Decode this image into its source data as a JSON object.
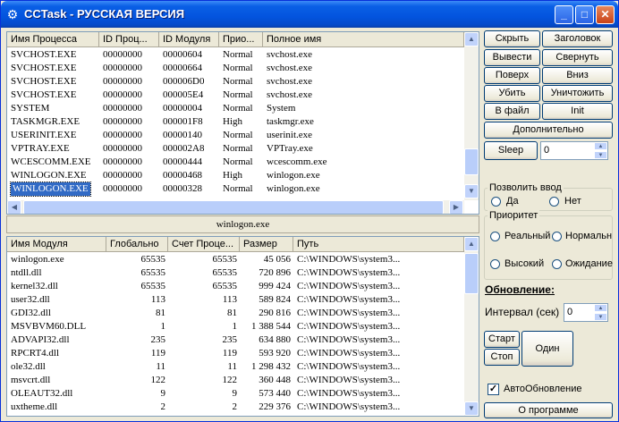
{
  "window": {
    "title": "CCTask - РУССКАЯ ВЕРСИЯ",
    "icon": "gear-icon",
    "min": "_",
    "max": "□",
    "close": "✕"
  },
  "processes": {
    "columns": [
      "Имя Процесса",
      "ID Проц...",
      "ID Модуля",
      "Прио...",
      "Полное имя"
    ],
    "rows": [
      [
        "SVCHOST.EXE",
        "00000000",
        "00000604",
        "Normal",
        "svchost.exe"
      ],
      [
        "SVCHOST.EXE",
        "00000000",
        "00000664",
        "Normal",
        "svchost.exe"
      ],
      [
        "SVCHOST.EXE",
        "00000000",
        "000006D0",
        "Normal",
        "svchost.exe"
      ],
      [
        "SVCHOST.EXE",
        "00000000",
        "000005E4",
        "Normal",
        "svchost.exe"
      ],
      [
        "SYSTEM",
        "00000000",
        "00000004",
        "Normal",
        "System"
      ],
      [
        "TASKMGR.EXE",
        "00000000",
        "000001F8",
        "High",
        "taskmgr.exe"
      ],
      [
        "USERINIT.EXE",
        "00000000",
        "00000140",
        "Normal",
        "userinit.exe"
      ],
      [
        "VPTRAY.EXE",
        "00000000",
        "000002A8",
        "Normal",
        "VPTray.exe"
      ],
      [
        "WCESCOMM.EXE",
        "00000000",
        "00000444",
        "Normal",
        "wcescomm.exe"
      ],
      [
        "WINLOGON.EXE",
        "00000000",
        "00000468",
        "High",
        "winlogon.exe"
      ],
      [
        "WINLOGON.EXE",
        "00000000",
        "00000328",
        "Normal",
        "winlogon.exe"
      ]
    ],
    "selected_index": 10
  },
  "selected_label": "winlogon.exe",
  "modules": {
    "columns": [
      "Имя Модуля",
      "Глобально",
      "Счет Проце...",
      "Размер",
      "Путь"
    ],
    "rows": [
      [
        "winlogon.exe",
        "65535",
        "65535",
        "45 056",
        "C:\\WINDOWS\\system3..."
      ],
      [
        "ntdll.dll",
        "65535",
        "65535",
        "720 896",
        "C:\\WINDOWS\\system3..."
      ],
      [
        "kernel32.dll",
        "65535",
        "65535",
        "999 424",
        "C:\\WINDOWS\\system3..."
      ],
      [
        "user32.dll",
        "113",
        "113",
        "589 824",
        "C:\\WINDOWS\\system3..."
      ],
      [
        "GDI32.dll",
        "81",
        "81",
        "290 816",
        "C:\\WINDOWS\\system3..."
      ],
      [
        "MSVBVM60.DLL",
        "1",
        "1",
        "1 388 544",
        "C:\\WINDOWS\\system3..."
      ],
      [
        "ADVAPI32.dll",
        "235",
        "235",
        "634 880",
        "C:\\WINDOWS\\system3..."
      ],
      [
        "RPCRT4.dll",
        "119",
        "119",
        "593 920",
        "C:\\WINDOWS\\system3..."
      ],
      [
        "ole32.dll",
        "11",
        "11",
        "1 298 432",
        "C:\\WINDOWS\\system3..."
      ],
      [
        "msvcrt.dll",
        "122",
        "122",
        "360 448",
        "C:\\WINDOWS\\system3..."
      ],
      [
        "OLEAUT32.dll",
        "9",
        "9",
        "573 440",
        "C:\\WINDOWS\\system3..."
      ],
      [
        "uxtheme.dll",
        "2",
        "2",
        "229 376",
        "C:\\WINDOWS\\system3..."
      ]
    ]
  },
  "buttons": {
    "hide": "Скрыть",
    "logo": "Заголовок",
    "show": "Вывести",
    "collapse": "Свернуть",
    "ontop": "Поверх",
    "down": "Вниз",
    "kill": "Убить",
    "destroy": "Уничтожить",
    "tofile": "В файл",
    "init": "Init",
    "more": "Дополнительно",
    "sleep": "Sleep"
  },
  "sleep_value": "0",
  "input_group": {
    "title": "Позволить ввод",
    "yes": "Да",
    "no": "Нет"
  },
  "priority_group": {
    "title": "Приоритет",
    "realtime": "Реальный",
    "normal": "Нормальн",
    "high": "Высокий",
    "idle": "Ожидание"
  },
  "update": {
    "title": "Обновление:",
    "interval_label": "Интервал (сек)",
    "interval_value": "0",
    "start": "Старт",
    "stop": "Стоп",
    "once": "Один",
    "auto_label": "АвтоОбновление",
    "auto_checked": true
  },
  "about": "О программе"
}
